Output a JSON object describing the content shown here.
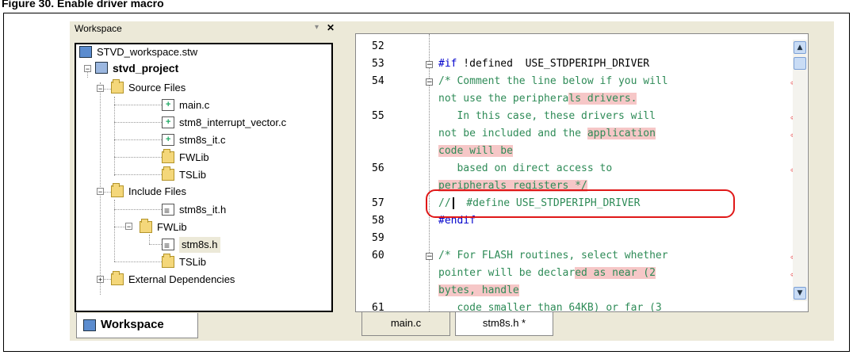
{
  "caption": "Figure 30. Enable driver macro",
  "workspace": {
    "title": "Workspace",
    "pin_glyph": "▾",
    "close_glyph": "✕",
    "tab_label": "Workspace",
    "tree": [
      {
        "label": "STVD_workspace.stw",
        "icon": "workspace-icon"
      },
      {
        "label": "stvd_project",
        "icon": "project-icon",
        "toggle": "−"
      },
      {
        "label": "Source Files",
        "icon": "folder-icon",
        "toggle": "−"
      },
      {
        "label": "main.c",
        "icon": "c-file-icon"
      },
      {
        "label": "stm8_interrupt_vector.c",
        "icon": "c-file-icon"
      },
      {
        "label": "stm8s_it.c",
        "icon": "c-file-icon"
      },
      {
        "label": "FWLib",
        "icon": "folder-icon"
      },
      {
        "label": "TSLib",
        "icon": "folder-icon"
      },
      {
        "label": "Include Files",
        "icon": "folder-icon",
        "toggle": "−"
      },
      {
        "label": "stm8s_it.h",
        "icon": "h-file-icon"
      },
      {
        "label": "FWLib",
        "icon": "folder-icon",
        "toggle": "−"
      },
      {
        "label": "stm8s.h",
        "icon": "h-file-icon",
        "selected": true
      },
      {
        "label": "TSLib",
        "icon": "folder-icon"
      },
      {
        "label": "External Dependencies",
        "icon": "folder-icon",
        "toggle": "+"
      }
    ]
  },
  "editor": {
    "line_numbers": [
      "52",
      "53",
      "54",
      "55",
      "56",
      "57",
      "58",
      "59",
      "60",
      "61"
    ],
    "code": {
      "l53_kw": "#if",
      "l53_rest": " !defined  USE_STDPERIPH_DRIVER",
      "l54_a": "/* Comment the line below if you will",
      "l54_b1": "not use the periphera",
      "l54_b2": "ls drivers.",
      "l55_a1": "   In this case, these drivers will",
      "l55_b1": "not be included and the ",
      "l55_b2": "application",
      "l55_c": "code will be",
      "l56_a": "   based on direct access to",
      "l56_b": "peripherals registers */",
      "l57": "//",
      "l57_rest": "  #define USE_STDPERIPH_DRIVER",
      "l58": "#endif",
      "l60_a": "/* For FLASH routines, select whether",
      "l60_b1": "pointer will be declar",
      "l60_b2": "ed as near (2",
      "l60_c": "bytes, handle",
      "l61": "   code smaller than 64KB) or far (3"
    },
    "wrap_mark": "⏎",
    "fold_minus": "−",
    "colors": {
      "comment": "#2e8b57",
      "keyword": "#0000cc",
      "highlight": "#f6c7c7",
      "annotation": "#e01818"
    }
  },
  "editor_tabs": [
    {
      "label": "main.c",
      "active": false
    },
    {
      "label": "stm8s.h *",
      "active": true
    }
  ]
}
